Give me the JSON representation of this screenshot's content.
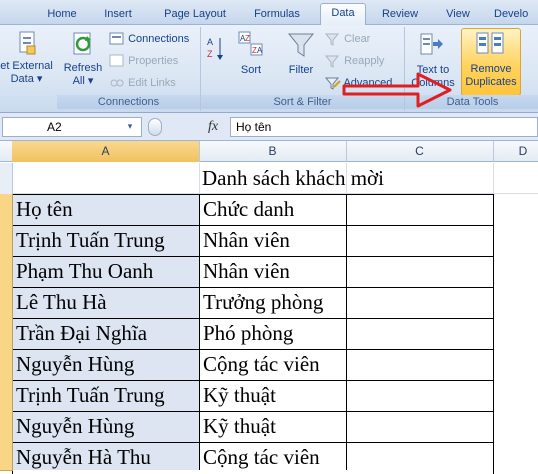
{
  "tabs": [
    "Home",
    "Insert",
    "Page Layout",
    "Formulas",
    "Data",
    "Review",
    "View",
    "Develo"
  ],
  "ribbon": {
    "get_external_data": [
      "et External",
      "Data ▾"
    ],
    "refresh_all": [
      "Refresh",
      "All ▾"
    ],
    "connections": "Connections",
    "properties": "Properties",
    "edit_links": "Edit Links",
    "connections_group": "Connections",
    "sort": "Sort",
    "filter": "Filter",
    "clear": "Clear",
    "reapply": "Reapply",
    "advanced": "Advanced",
    "sort_filter_group": "Sort & Filter",
    "text_to_columns": [
      "Text to",
      "Columns"
    ],
    "remove_duplicates": [
      "Remove",
      "Duplicates"
    ],
    "data_tools_group": "Data Tools"
  },
  "formula_bar": {
    "name_box": "A2",
    "fx": "fx",
    "value": "Họ tên"
  },
  "columns": [
    "A",
    "B",
    "C",
    "D"
  ],
  "title": "Danh sách khách mời",
  "rows": [
    [
      "Họ tên",
      "Chức danh"
    ],
    [
      "Trịnh Tuấn Trung",
      "Nhân viên"
    ],
    [
      "Phạm Thu Oanh",
      "Nhân viên"
    ],
    [
      "Lê Thu Hà",
      "Trưởng phòng"
    ],
    [
      "Trần Đại Nghĩa",
      "Phó phòng"
    ],
    [
      "Nguyễn Hùng",
      "Cộng tác viên"
    ],
    [
      "Trịnh Tuấn Trung",
      "Kỹ thuật"
    ],
    [
      "Nguyễn Hùng",
      "Kỹ thuật"
    ],
    [
      "Nguyễn Hà Thu",
      "Cộng tác viên"
    ]
  ],
  "colors": {
    "accent": "#f1c15f",
    "arrow": "#e02020",
    "selection": "#dde5f2"
  }
}
